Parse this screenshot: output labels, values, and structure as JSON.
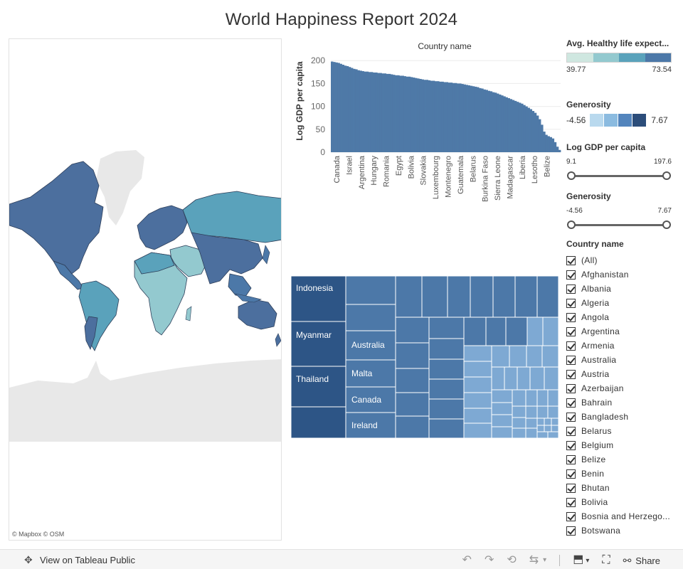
{
  "title": "World Happiness Report 2024",
  "map": {
    "credit": "© Mapbox  © OSM"
  },
  "bar_chart_header": "Country name",
  "chart_data": {
    "type": "bar",
    "title": "Country name",
    "xlabel": "",
    "ylabel": "Log GDP per capita",
    "ylim": [
      0,
      205
    ],
    "yticks": [
      0,
      50,
      100,
      150,
      200
    ],
    "tick_labels": [
      "Canada",
      "Israel",
      "Argentina",
      "Hungary",
      "Romania",
      "Egypt",
      "Bolivia",
      "Slovakia",
      "Luxembourg",
      "Montenegro",
      "Guatemala",
      "Belarus",
      "Burkina Faso",
      "Sierra Leone",
      "Madagascar",
      "Liberia",
      "Lesotho",
      "Belize"
    ],
    "values": [
      198,
      197,
      196,
      195,
      193,
      191,
      189,
      188,
      186,
      184,
      182,
      181,
      179,
      178,
      177,
      176,
      176,
      175,
      175,
      174,
      174,
      173,
      173,
      172,
      172,
      171,
      171,
      170,
      169,
      168,
      168,
      167,
      167,
      166,
      165,
      165,
      164,
      163,
      162,
      161,
      160,
      159,
      158,
      158,
      157,
      156,
      156,
      155,
      155,
      154,
      154,
      153,
      153,
      152,
      152,
      151,
      151,
      150,
      150,
      149,
      148,
      147,
      146,
      145,
      144,
      143,
      142,
      140,
      139,
      137,
      136,
      134,
      133,
      131,
      130,
      128,
      126,
      124,
      122,
      120,
      118,
      116,
      114,
      112,
      110,
      108,
      106,
      103,
      100,
      97,
      94,
      90,
      86,
      80,
      72,
      60,
      45,
      38,
      35,
      33,
      30,
      22,
      12,
      5
    ]
  },
  "treemap": {
    "labels": {
      "indonesia": "Indonesia",
      "myanmar": "Myanmar",
      "thailand": "Thailand",
      "australia": "Australia",
      "malta": "Malta",
      "canada": "Canada",
      "ireland": "Ireland"
    }
  },
  "legend_life": {
    "title": "Avg. Healthy life expect...",
    "min": "39.77",
    "max": "73.54",
    "colors": [
      "#cfe7e0",
      "#93c9cf",
      "#5aa2bb",
      "#4c78a8"
    ]
  },
  "legend_generosity": {
    "title": "Generosity",
    "min": "-4.56",
    "max": "7.67",
    "colors": [
      "#b9d9ee",
      "#8bbbe0",
      "#5385bd",
      "#2c4d7a"
    ]
  },
  "slider_gdp": {
    "title": "Log GDP per capita",
    "min": "9.1",
    "max": "197.6"
  },
  "slider_generosity": {
    "title": "Generosity",
    "min": "-4.56",
    "max": "7.67"
  },
  "country_filter": {
    "title": "Country name",
    "items": [
      "(All)",
      "Afghanistan",
      "Albania",
      "Algeria",
      "Angola",
      "Argentina",
      "Armenia",
      "Australia",
      "Austria",
      "Azerbaijan",
      "Bahrain",
      "Bangladesh",
      "Belarus",
      "Belgium",
      "Belize",
      "Benin",
      "Bhutan",
      "Bolivia",
      "Bosnia and Herzego...",
      "Botswana"
    ]
  },
  "toolbar": {
    "view_label": "View on Tableau Public",
    "share_label": "Share"
  }
}
